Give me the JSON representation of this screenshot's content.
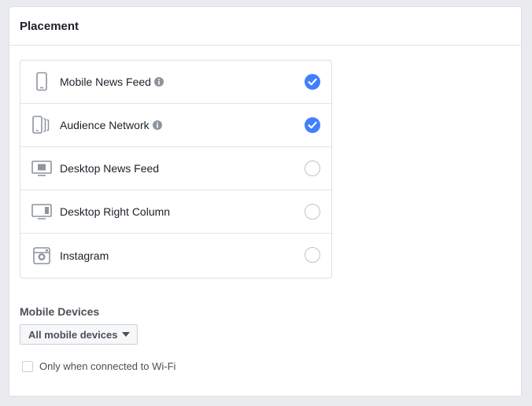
{
  "placement": {
    "title": "Placement",
    "items": [
      {
        "label": "Mobile News Feed",
        "icon": "mobile-phone-icon",
        "info": true,
        "checked": true
      },
      {
        "label": "Audience Network",
        "icon": "audience-network-icon",
        "info": true,
        "checked": true
      },
      {
        "label": "Desktop News Feed",
        "icon": "desktop-news-feed-icon",
        "info": false,
        "checked": false
      },
      {
        "label": "Desktop Right Column",
        "icon": "desktop-right-column-icon",
        "info": false,
        "checked": false
      },
      {
        "label": "Instagram",
        "icon": "instagram-icon",
        "info": false,
        "checked": false
      }
    ]
  },
  "mobile_devices": {
    "label": "Mobile Devices",
    "dropdown_value": "All mobile devices",
    "wifi_label": "Only when connected to Wi-Fi",
    "wifi_checked": false
  },
  "colors": {
    "accent": "#4080ff",
    "icon_gray": "#8d949e"
  }
}
